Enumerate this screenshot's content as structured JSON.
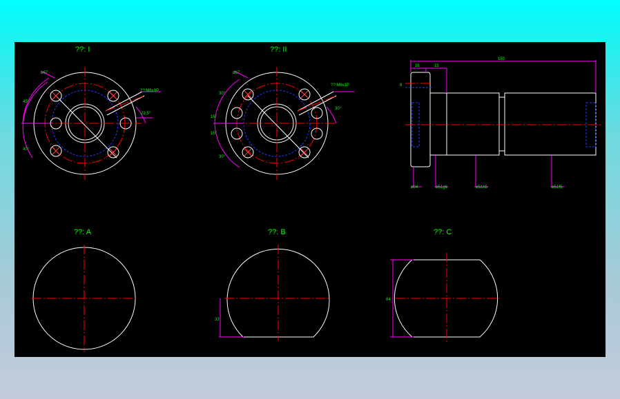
{
  "views": {
    "view_1_title": "??: I",
    "view_2_title": "??: II",
    "view_a_title": "??: A",
    "view_b_title": "??: B",
    "view_c_title": "??: C"
  },
  "dimensions": {
    "pcd_1": "ø67",
    "pcd_2": "ø67",
    "thread_1": "??:M6x1P",
    "thread_2": "??:M6x1P",
    "angle_45_top": "45°",
    "angle_45_bottom": "40°",
    "angle_22": "22.5°",
    "angle_30_a": "30°",
    "angle_15_a": "15°",
    "angle_15_b": "15°",
    "angle_30_b": "30°",
    "angle_30_right": "30°",
    "length_total": "153",
    "length_16": "16",
    "length_15": "15",
    "side_dim": "8",
    "dia_84": "ø84",
    "dia_1": "ø51g6",
    "dia_2": "ø51h5",
    "dia_3": "ø51f5",
    "flat_b": "33",
    "width_c": "84"
  },
  "colors": {
    "background": "#000000",
    "outline": "#ffffff",
    "centerline": "#ff0000",
    "hidden": "#1f3cff",
    "dimension": "#ff00ff",
    "text": "#00ff00"
  }
}
